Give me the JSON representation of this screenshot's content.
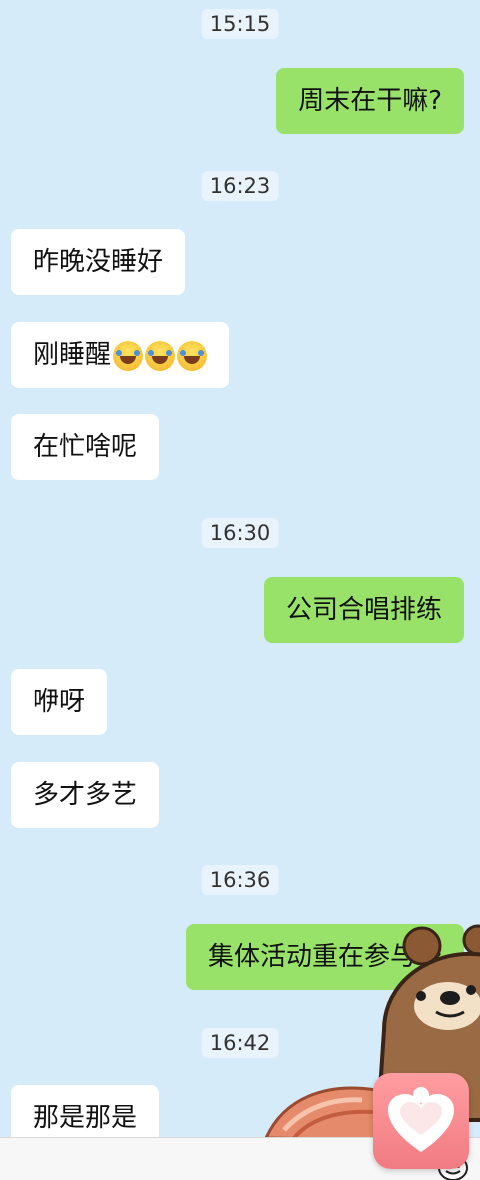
{
  "chat": {
    "messages": [
      {
        "time": "15:15"
      },
      {
        "text": "周末在干嘛?"
      },
      {
        "time": "16:23"
      },
      {
        "text": "昨晚没睡好"
      },
      {
        "text": "刚睡醒"
      },
      {
        "text": "在忙啥呢"
      },
      {
        "time": "16:30"
      },
      {
        "text": "公司合唱排练"
      },
      {
        "text": "咿呀"
      },
      {
        "text": "多才多艺"
      },
      {
        "time": "16:36"
      },
      {
        "text": "集体活动重在参与～"
      },
      {
        "time": "16:42"
      },
      {
        "text": "那是那是"
      }
    ]
  },
  "colors": {
    "background": "#d6ebf9",
    "sent_bubble": "#99e26a",
    "received_bubble": "#ffffff"
  }
}
